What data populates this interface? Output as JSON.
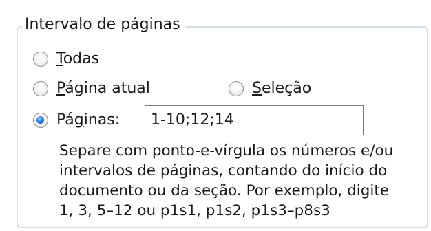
{
  "group": {
    "title": "Intervalo de páginas"
  },
  "options": {
    "todas": {
      "first_letter": "T",
      "rest": "odas",
      "checked": false
    },
    "pagina_atual": {
      "first_letter": "P",
      "rest": "ágina atual",
      "checked": false
    },
    "selecao": {
      "first_letter": "S",
      "rest": "eleção",
      "checked": false
    },
    "paginas": {
      "before": "Pá",
      "accel": "g",
      "after": "inas:",
      "checked": true
    }
  },
  "pages_field": {
    "value": "1-10;12;14"
  },
  "help": {
    "lines": [
      "Separe com ponto-e-vírgula os números e/ou",
      "intervalos de páginas, contando do início do",
      "documento ou da seção. Por exemplo, digite",
      "1, 3, 5–12 ou p1s1, p1s2, p1s3–p8s3"
    ]
  }
}
